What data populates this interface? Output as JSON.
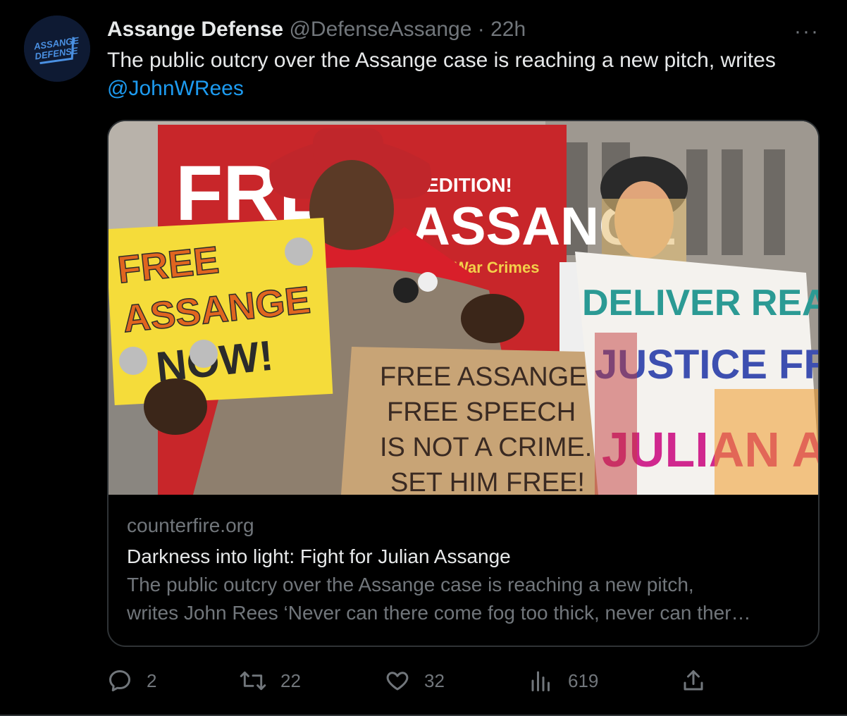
{
  "author": {
    "name": "Assange Defense",
    "handle": "@DefenseAssange",
    "separator": "·",
    "time": "22h",
    "avatar_text_line1": "ASSANGE",
    "avatar_text_line2": "DEFENSE"
  },
  "more_label": "···",
  "tweet": {
    "text": "The public outcry over the Assange case is reaching a new pitch, writes",
    "mention": "@JohnWRees"
  },
  "card": {
    "image_signs": {
      "sign1_line1": "FREE",
      "sign1_line2": "ASSANGE",
      "sign1_line3": "NOW!",
      "sign2_line1": "FREE ASSANGE",
      "sign2_line2": "FREE SPEECH",
      "sign2_line3": "IS NOT A CRIME.",
      "sign2_line4": "SET HIM FREE!",
      "sign3_line1": "DELIVER REAL",
      "sign3_line2": "JUSTICE FREE",
      "sign3_line3": "JULIAN ASSANGE",
      "banner_text": "ASSANGE",
      "banner_top": "EDITION!",
      "banner_sub": "War Crimes",
      "banner_free": "FREE"
    },
    "domain": "counterfire.org",
    "title": "Darkness into light: Fight for Julian Assange",
    "description_line1": "The public outcry over the Assange case is reaching a new pitch,",
    "description_line2": "writes John Rees ‘Never can there come fog too thick, never can ther…"
  },
  "actions": {
    "replies": "2",
    "retweets": "22",
    "likes": "32",
    "views": "619"
  },
  "colors": {
    "background": "#000000",
    "text": "#e7e9ea",
    "secondary": "#71767b",
    "link": "#1d9bf0",
    "border": "#2f3336"
  }
}
